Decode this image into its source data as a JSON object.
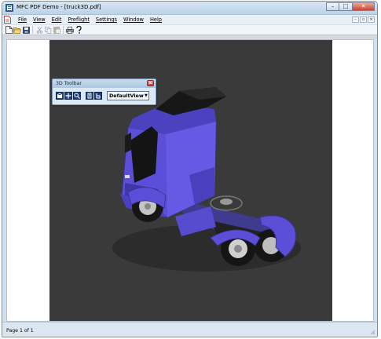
{
  "window": {
    "title": "MFC PDF Demo - [truck3D.pdf]",
    "caption_buttons": [
      {
        "name": "minimize-button",
        "glyph": "–"
      },
      {
        "name": "maximize-button",
        "glyph": "□"
      },
      {
        "name": "close-button",
        "glyph": "✕"
      }
    ]
  },
  "menubar": {
    "items": [
      "File",
      "View",
      "Edit",
      "Preflight",
      "Settings",
      "Window",
      "Help"
    ],
    "mdi_buttons": [
      "–",
      "▫",
      "×"
    ]
  },
  "toolbar": {
    "icons": [
      "new-icon",
      "open-icon",
      "save-icon",
      "cut-icon",
      "copy-icon",
      "paste-icon",
      "print-icon",
      "help-icon"
    ]
  },
  "toolbar3d": {
    "title": "3D Toolbar",
    "icons": [
      "rotate-icon",
      "pan-icon",
      "zoom-icon",
      "views-icon",
      "default-view-icon"
    ],
    "view_select": "DefaultView",
    "close_glyph": "x"
  },
  "viewport": {
    "background": "#3a3a3a",
    "truck_color": "#5a4fd6"
  },
  "statusbar": {
    "text": "Page 1 of 1"
  }
}
